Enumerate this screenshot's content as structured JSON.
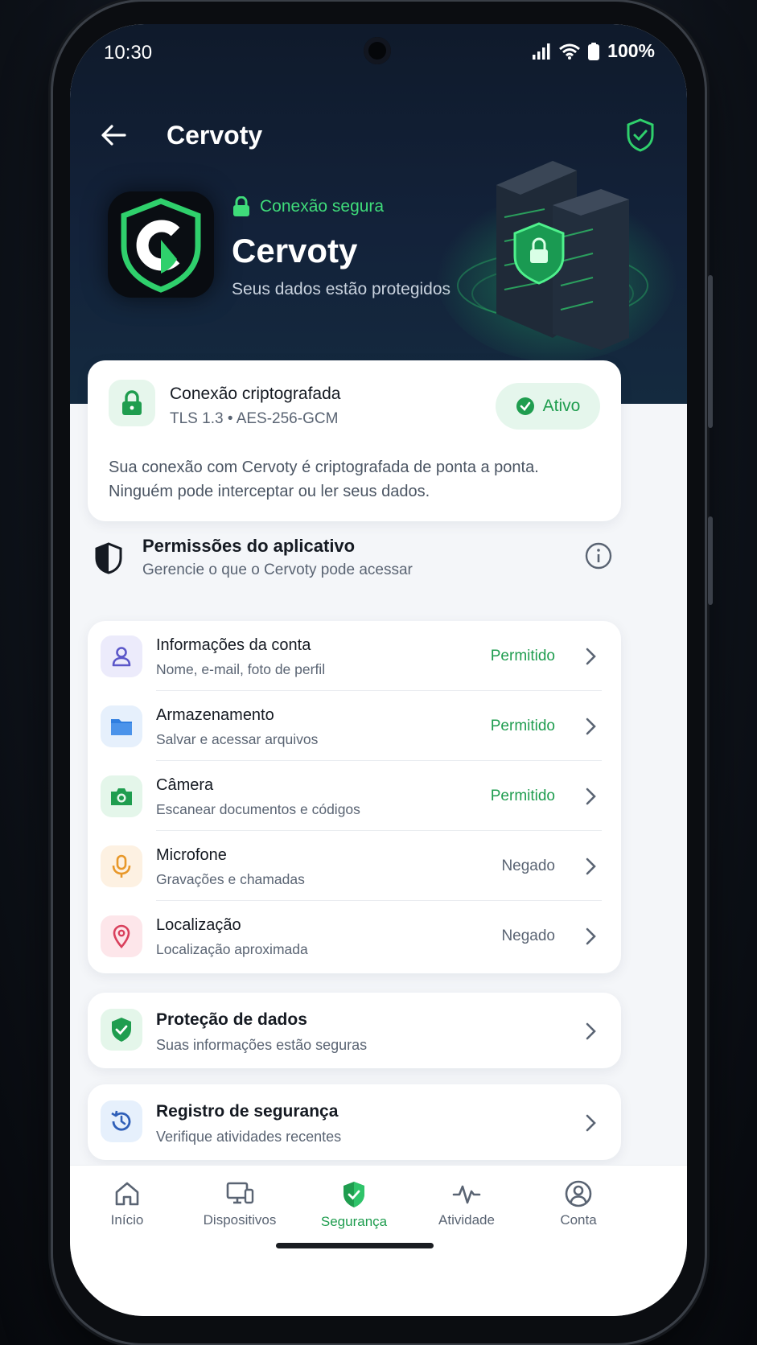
{
  "status_bar": {
    "time": "10:30",
    "battery": "100%"
  },
  "app_bar": {
    "title": "Cervoty"
  },
  "hero": {
    "secure_label": "Conexão segura",
    "app_name": "Cervoty",
    "subtitle": "Seus dados estão protegidos",
    "logo_letter": "C"
  },
  "encryption_card": {
    "title": "Conexão criptografada",
    "protocol": "TLS 1.3 • AES-256-GCM",
    "status": "Ativo",
    "description_line1": "Sua conexão com Cervoty é criptografada de ponta a ponta.",
    "description_line2": "Ninguém pode interceptar ou ler seus dados."
  },
  "permissions": {
    "title": "Permissões do aplicativo",
    "subtitle": "Gerencie o que o Cervoty pode acessar",
    "items": [
      {
        "title": "Informações da conta",
        "subtitle": "Nome, e-mail, foto de perfil",
        "status": "Permitido",
        "icon": "user-icon"
      },
      {
        "title": "Armazenamento",
        "subtitle": "Salvar e acessar arquivos",
        "status": "Permitido",
        "icon": "folder-icon"
      },
      {
        "title": "Câmera",
        "subtitle": "Escanear documentos e códigos",
        "status": "Permitido",
        "icon": "camera-icon"
      },
      {
        "title": "Microfone",
        "subtitle": "Gravações e chamadas",
        "status": "Negado",
        "icon": "microphone-icon"
      },
      {
        "title": "Localização",
        "subtitle": "Localização aproximada",
        "status": "Negado",
        "icon": "location-pin-icon"
      }
    ]
  },
  "data_protection": {
    "title": "Proteção de dados",
    "subtitle": "Suas informações estão seguras"
  },
  "security_log": {
    "title": "Registro de segurança",
    "subtitle": "Verifique atividades recentes"
  },
  "bottom_nav": {
    "tabs": [
      {
        "label": "Início",
        "icon": "home-icon"
      },
      {
        "label": "Dispositivos",
        "icon": "devices-icon"
      },
      {
        "label": "Segurança",
        "icon": "shield-icon",
        "active": true
      },
      {
        "label": "Atividade",
        "icon": "activity-icon"
      },
      {
        "label": "Conta",
        "icon": "account-icon"
      }
    ]
  },
  "colors": {
    "accent_green": "#1f9d4f",
    "hero_bg": "#0f1a2b",
    "denied_gray": "#5a6473"
  }
}
